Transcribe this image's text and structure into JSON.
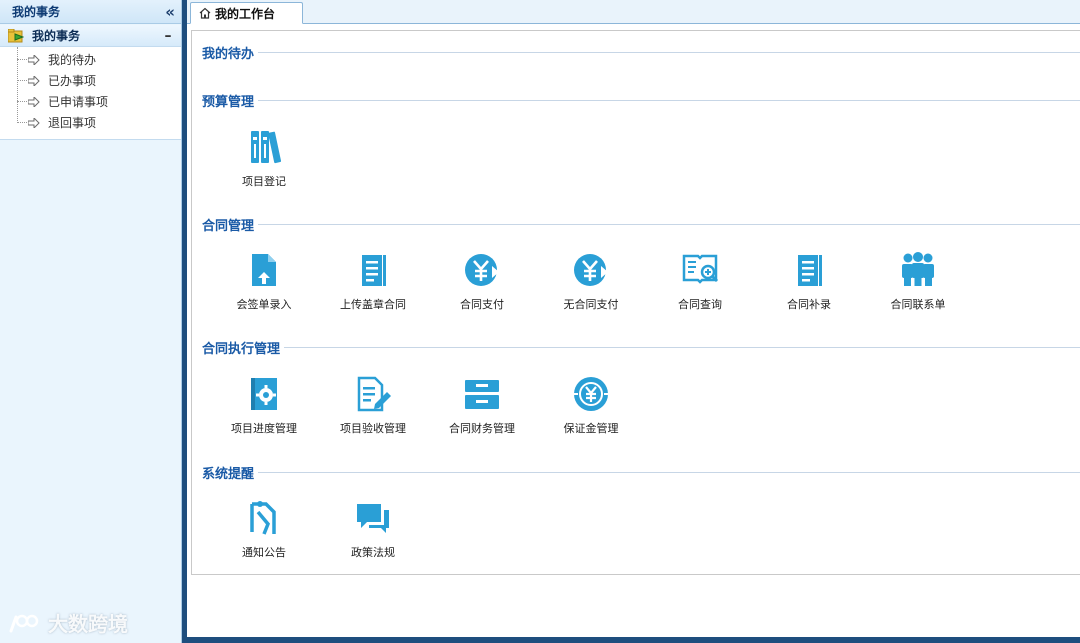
{
  "sidebar": {
    "header_title": "我的事务",
    "collapse_glyph": "«",
    "group": {
      "label": "我的事务",
      "toggle": "–",
      "icon": "folder-arrow-icon"
    },
    "items": [
      {
        "label": "我的待办",
        "icon": "arrow-right-icon"
      },
      {
        "label": "已办事项",
        "icon": "arrow-right-icon"
      },
      {
        "label": "已申请事项",
        "icon": "arrow-right-icon"
      },
      {
        "label": "退回事项",
        "icon": "arrow-right-icon"
      }
    ]
  },
  "tabs": [
    {
      "label": "我的工作台",
      "icon": "home-icon"
    }
  ],
  "sections": {
    "todo": {
      "title": "我的待办"
    },
    "budget": {
      "title": "预算管理",
      "tiles": [
        {
          "label": "项目登记",
          "icon": "books-icon"
        }
      ]
    },
    "contract": {
      "title": "合同管理",
      "tiles": [
        {
          "label": "会签单录入",
          "icon": "document-upload-icon"
        },
        {
          "label": "上传盖章合同",
          "icon": "notebook-icon"
        },
        {
          "label": "合同支付",
          "icon": "yuan-payment-icon"
        },
        {
          "label": "无合同支付",
          "icon": "yuan-payment-icon"
        },
        {
          "label": "合同查询",
          "icon": "book-search-icon"
        },
        {
          "label": "合同补录",
          "icon": "notebook-icon"
        },
        {
          "label": "合同联系单",
          "icon": "people-group-icon"
        }
      ]
    },
    "execution": {
      "title": "合同执行管理",
      "tiles": [
        {
          "label": "项目进度管理",
          "icon": "book-gear-icon"
        },
        {
          "label": "项目验收管理",
          "icon": "document-edit-icon"
        },
        {
          "label": "合同财务管理",
          "icon": "drawer-icon"
        },
        {
          "label": "保证金管理",
          "icon": "yuan-coin-icon"
        }
      ]
    },
    "reminder": {
      "title": "系统提醒",
      "tiles": [
        {
          "label": "通知公告",
          "icon": "notice-icon"
        },
        {
          "label": "政策法规",
          "icon": "chat-bubbles-icon"
        }
      ]
    }
  },
  "watermark": {
    "text": "大数跨境"
  },
  "colors": {
    "accent": "#1a5aa6",
    "icon": "#2a9fd6",
    "splitter": "#1e4e7e"
  }
}
